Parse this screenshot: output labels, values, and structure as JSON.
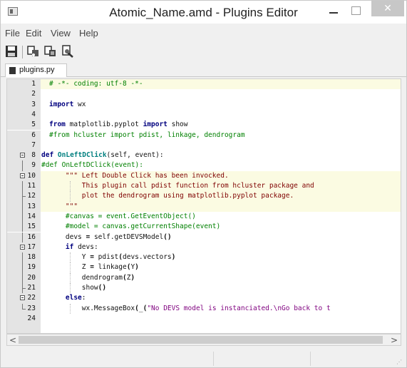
{
  "window": {
    "title": "Atomic_Name.amd - Plugins Editor"
  },
  "menu": [
    "File",
    "Edit",
    "View",
    "Help"
  ],
  "toolbar": {
    "buttons": [
      "save-icon",
      "cut-icon",
      "paste-icon",
      "tools-icon"
    ]
  },
  "tab": {
    "label": "plugins.py"
  },
  "editor": {
    "line_numbers": [
      "1",
      "2",
      "3",
      "4",
      "5",
      "6",
      "7",
      "8",
      "9",
      "10",
      "11",
      "12",
      "13",
      "14",
      "15",
      "16",
      "17",
      "18",
      "19",
      "20",
      "21",
      "22",
      "23",
      "24"
    ],
    "lines": [
      "# -*- coding: utf-8 -*-",
      "",
      "import wx",
      "",
      "from matplotlib.pyplot import show",
      "#from hcluster import pdist, linkage, dendrogram",
      "",
      "def OnLeftDClick(self, event):",
      "#def OnLeftDClick(event):",
      "    \"\"\" Left Double Click has been invocked.",
      "        This plugin call pdist function from hcluster package and",
      "        plot the dendrogram using matplotlib.pyplot package.",
      "    \"\"\"",
      "    #canvas = event.GetEventObject()",
      "    #model = canvas.getCurrentShape(event)",
      "    devs = self.getDEVSModel()",
      "    if devs:",
      "        Y = pdist(devs.vectors)",
      "        Z = linkage(Y)",
      "        dendrogram(Z)",
      "        show()",
      "    else:",
      "        wx.MessageBox(_(\"No DEVS model is instanciated.\\nGo back to t",
      ""
    ]
  }
}
